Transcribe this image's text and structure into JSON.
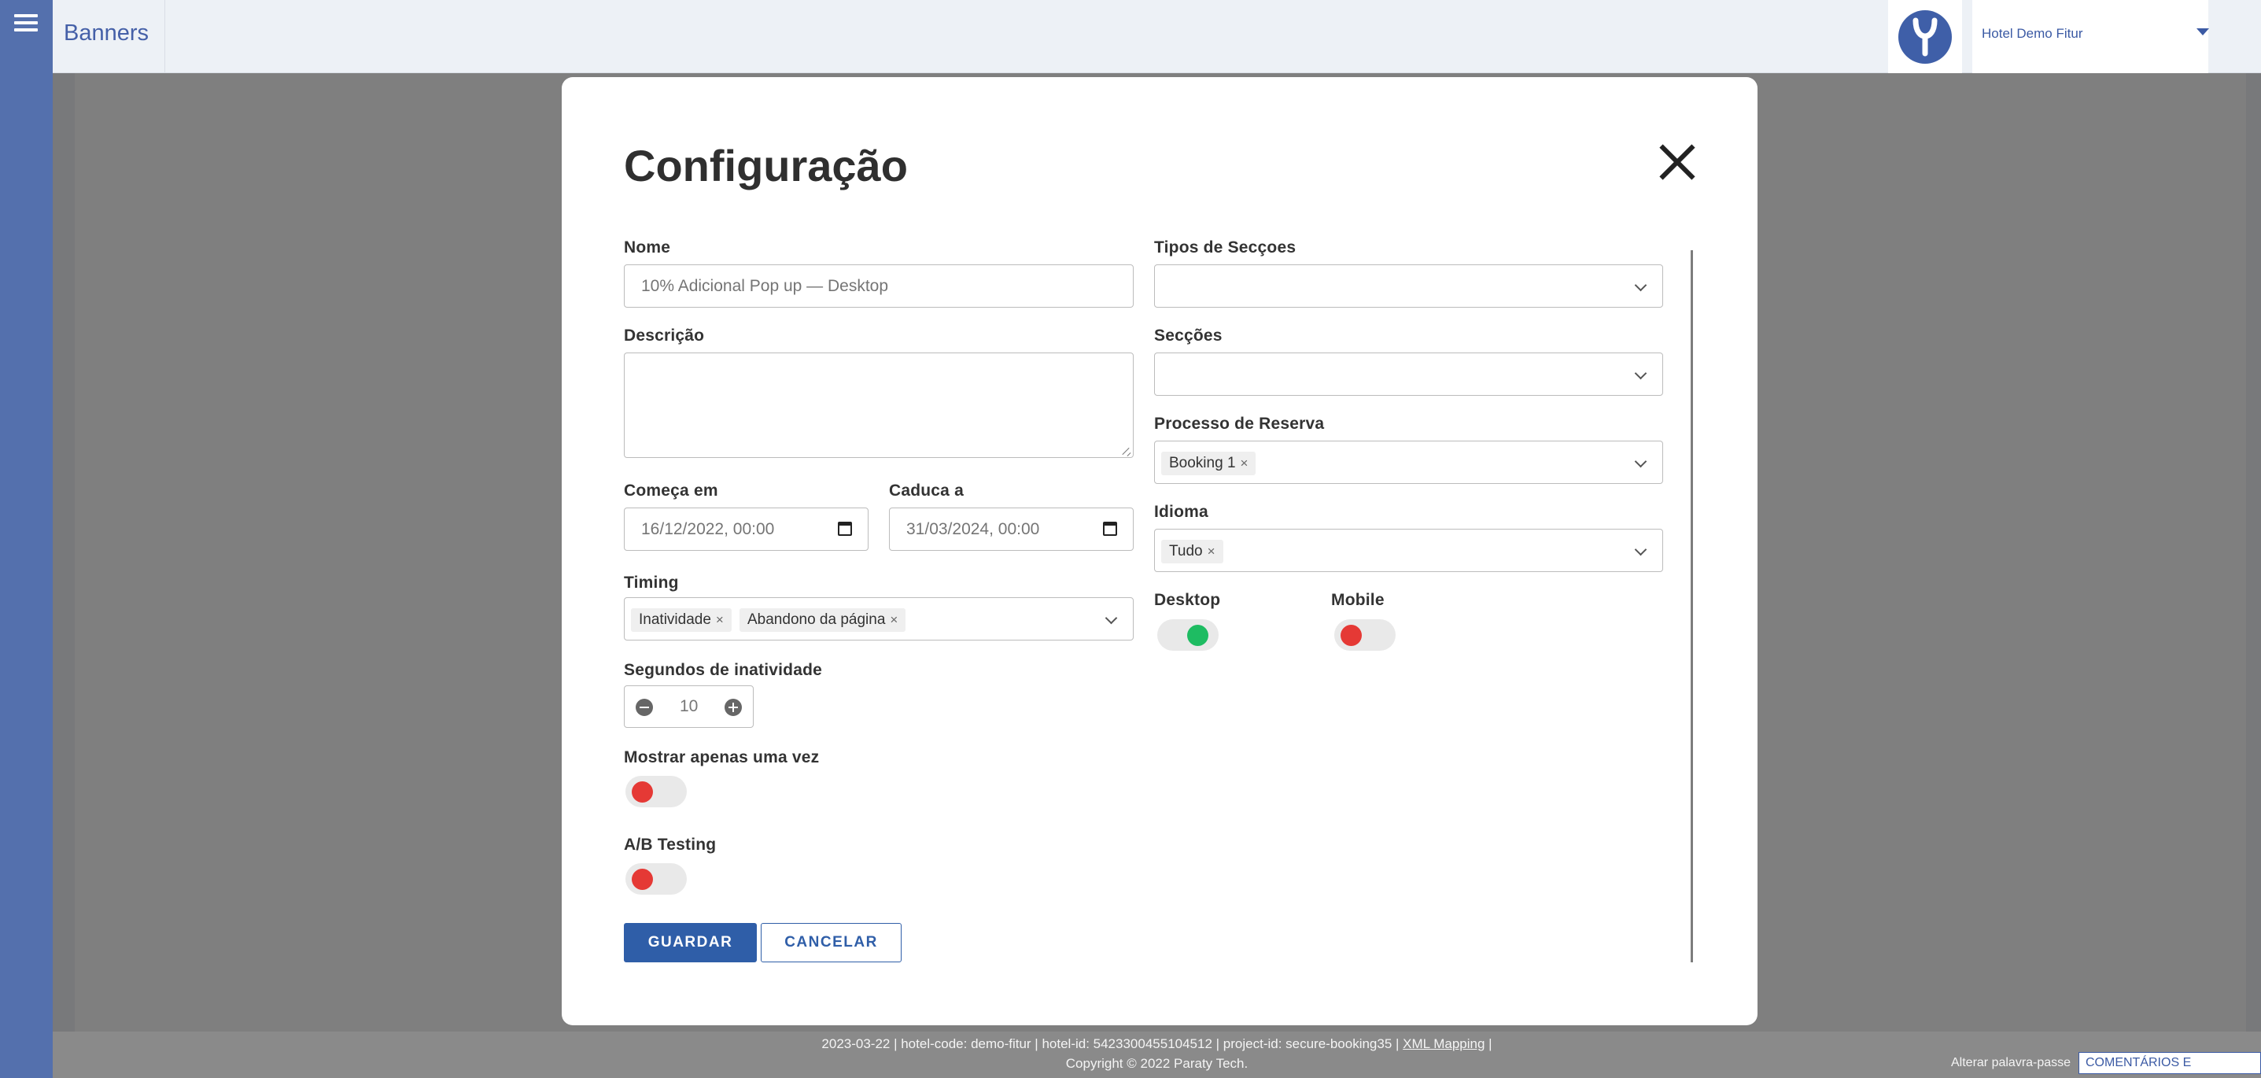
{
  "header": {
    "page_title": "Banners",
    "hotel_name": "Hotel Demo Fitur"
  },
  "modal": {
    "title": "Configuração",
    "left": {
      "nome_label": "Nome",
      "nome_placeholder": "10% Adicional Pop up — Desktop",
      "descricao_label": "Descrição",
      "descricao_value": "",
      "comeca_label": "Começa em",
      "comeca_value": "16/12/2022, 00:00",
      "caduca_label": "Caduca a",
      "caduca_value": "31/03/2024, 00:00",
      "timing_label": "Timing",
      "timing_chips": [
        "Inatividade",
        "Abandono da página"
      ],
      "segundos_label": "Segundos de inatividade",
      "segundos_value": "10",
      "mostrar_label": "Mostrar apenas uma vez",
      "mostrar_enabled": false,
      "ab_label": "A/B Testing",
      "ab_enabled": false
    },
    "right": {
      "tipos_label": "Tipos de Secçoes",
      "tipos_value": "",
      "seccoes_label": "Secções",
      "seccoes_value": "",
      "processo_label": "Processo de Reserva",
      "processo_chips": [
        "Booking 1"
      ],
      "idioma_label": "Idioma",
      "idioma_chips": [
        "Tudo"
      ],
      "desktop_label": "Desktop",
      "desktop_enabled": true,
      "mobile_label": "Mobile",
      "mobile_enabled": false
    },
    "buttons": {
      "save": "GUARDAR",
      "cancel": "CANCELAR"
    }
  },
  "footer": {
    "info_text": "2023-03-22 | hotel-code: demo-fitur | hotel-id: 5423300455104512 | project-id: secure-booking35 |",
    "xml_link": "XML Mapping",
    "info_end": "|",
    "copyright": "Copyright © 2022 Paraty Tech.",
    "change_password": "Alterar palavra-passe",
    "support": "COMENTÁRIOS E SUPORTE"
  },
  "colors": {
    "rail": "#5470ad",
    "primary": "#2f5ea8",
    "toggle_on": "#1ebc62",
    "toggle_off": "#e53935"
  }
}
